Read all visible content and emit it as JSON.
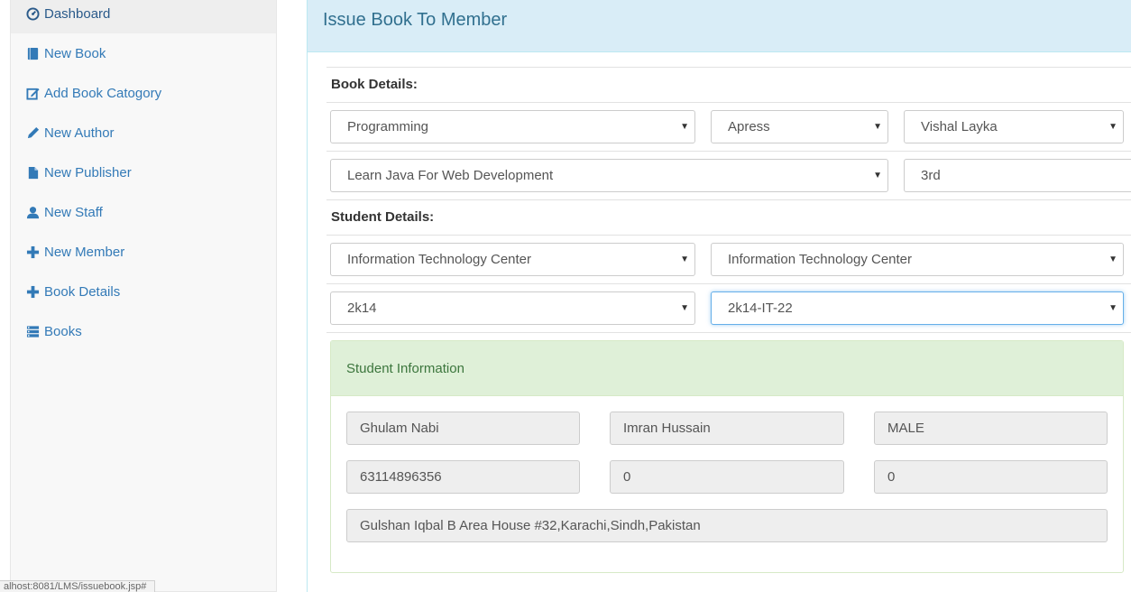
{
  "sidebar": {
    "items": [
      {
        "label": "Dashboard",
        "icon": "dashboard-icon"
      },
      {
        "label": "New Book",
        "icon": "book-icon"
      },
      {
        "label": "Add Book Catogory",
        "icon": "edit-icon"
      },
      {
        "label": "New Author",
        "icon": "pencil-icon"
      },
      {
        "label": "New Publisher",
        "icon": "file-icon"
      },
      {
        "label": "New Staff",
        "icon": "user-icon"
      },
      {
        "label": "New Member",
        "icon": "plus-icon"
      },
      {
        "label": "Book Details",
        "icon": "plus-icon"
      },
      {
        "label": "Books",
        "icon": "list-icon"
      }
    ]
  },
  "status_url": "alhost:8081/LMS/issuebook.jsp#",
  "panel": {
    "title": "Issue Book To Member",
    "book_details_label": "Book Details:",
    "book": {
      "category": "Programming",
      "publisher": "Apress",
      "author": "Vishal Layka",
      "title": "Learn Java For Web Development",
      "edition": "3rd"
    },
    "student_details_label": "Student Details:",
    "student_select": {
      "institute": "Information Technology Center",
      "department": "Information Technology Center",
      "batch": "2k14",
      "roll_no": "2k14-IT-22"
    },
    "student_info": {
      "heading": "Student Information",
      "name": "Ghulam Nabi",
      "father_name": "Imran Hussain",
      "gender": "MALE",
      "cnic": "63114896356",
      "field5": "0",
      "field6": "0",
      "address": "Gulshan Iqbal B Area House #32,Karachi,Sindh,Pakistan"
    }
  },
  "colors": {
    "link": "#337ab7",
    "panel_heading_bg": "#d9edf7",
    "panel_heading_text": "#31708f",
    "info_heading_bg": "#dff0d8",
    "info_heading_text": "#3c763d"
  }
}
